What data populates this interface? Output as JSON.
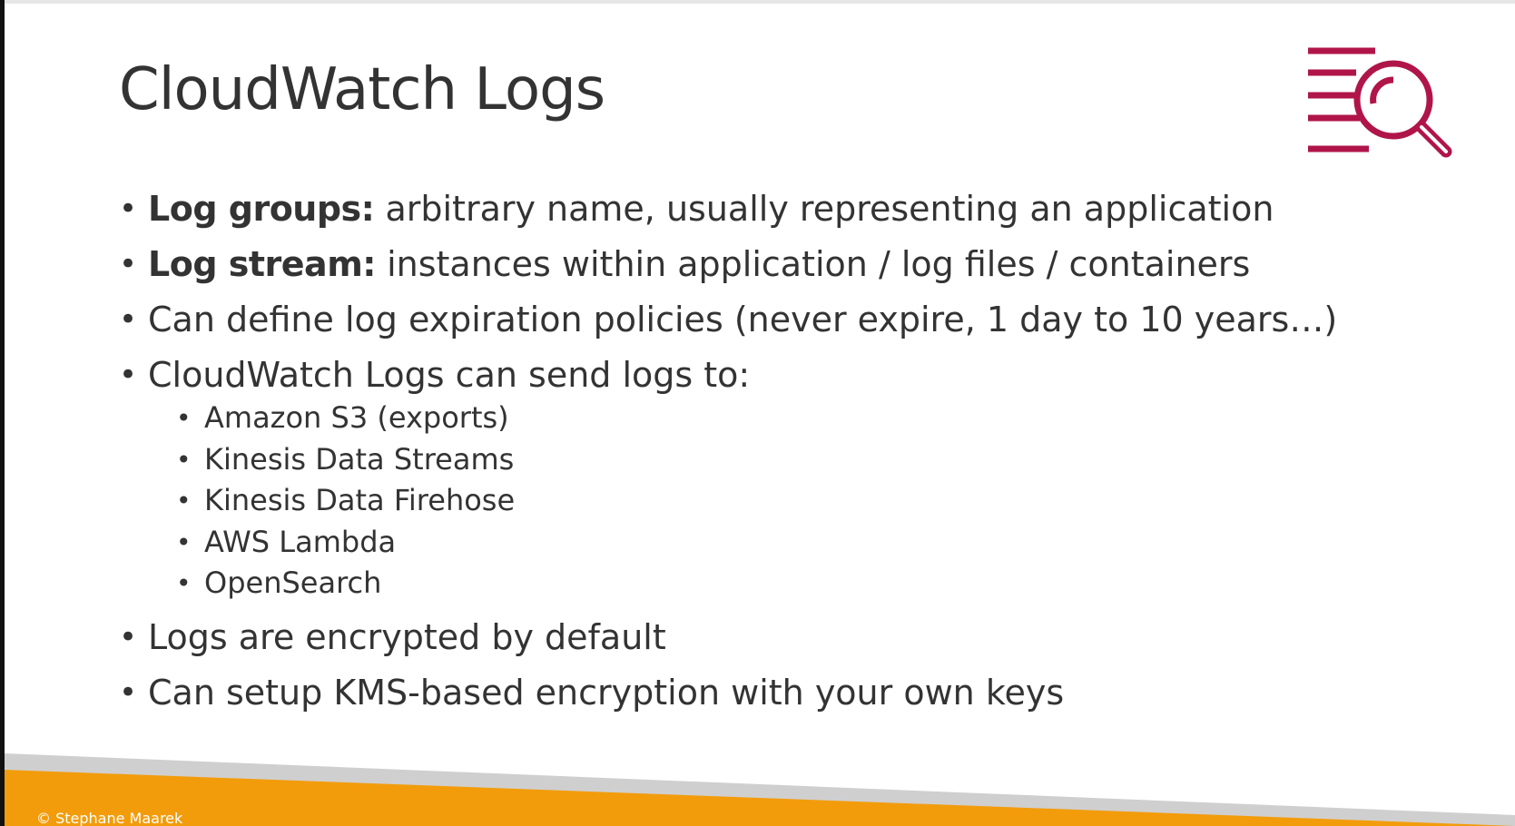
{
  "slide": {
    "title": "CloudWatch Logs",
    "copyright": "© Stephane Maarek",
    "logo_icon": "log-search-icon",
    "accent_color": "#b0154a",
    "footer_orange": "#f29c0c",
    "footer_gray": "#cfcfcf",
    "bullets": [
      {
        "bold": "Log groups:",
        "text": " arbitrary name, usually representing an application"
      },
      {
        "bold": "Log stream:",
        "text": " instances within application / log files / containers"
      },
      {
        "bold": "",
        "text": "Can define log expiration policies (never expire, 1 day to 10 years…)"
      },
      {
        "bold": "",
        "text": "CloudWatch Logs can send logs to:"
      },
      {
        "bold": "",
        "text": "Logs are encrypted by default"
      },
      {
        "bold": "",
        "text": "Can setup KMS-based encryption with your own keys"
      }
    ],
    "sub_bullets": [
      "Amazon S3 (exports)",
      "Kinesis Data Streams",
      "Kinesis Data Firehose",
      "AWS Lambda",
      "OpenSearch"
    ]
  }
}
